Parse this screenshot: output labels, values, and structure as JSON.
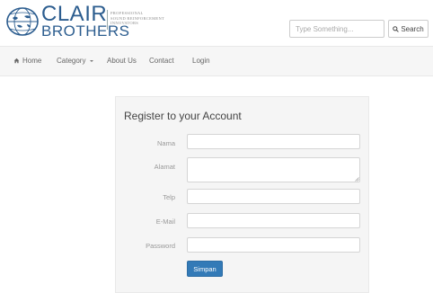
{
  "brand": {
    "name_top": "CLAIR",
    "name_bottom": "BROTHERS",
    "tagline": [
      "PROFESSIONAL",
      "SOUND REINFORCEMENT",
      "INNOVATORS"
    ],
    "logo_icon": "clair-globe-logo",
    "color": "#2c5d8f"
  },
  "search": {
    "placeholder": "Type Something...",
    "button_label": "Search",
    "icon": "search-icon"
  },
  "nav": {
    "items": [
      {
        "label": "Home",
        "icon": "home-icon"
      },
      {
        "label": "Category",
        "icon": "chevron-down-icon"
      },
      {
        "label": "About Us"
      },
      {
        "label": "Contact"
      },
      {
        "label": "Login"
      }
    ]
  },
  "form": {
    "title": "Register to your Account",
    "fields": [
      {
        "label": "Nama",
        "value": ""
      },
      {
        "label": "Alamat",
        "value": ""
      },
      {
        "label": "Telp",
        "value": ""
      },
      {
        "label": "E-Mail",
        "value": ""
      },
      {
        "label": "Password",
        "value": ""
      }
    ],
    "submit_label": "Simpan",
    "submit_color": "#337ab7"
  }
}
